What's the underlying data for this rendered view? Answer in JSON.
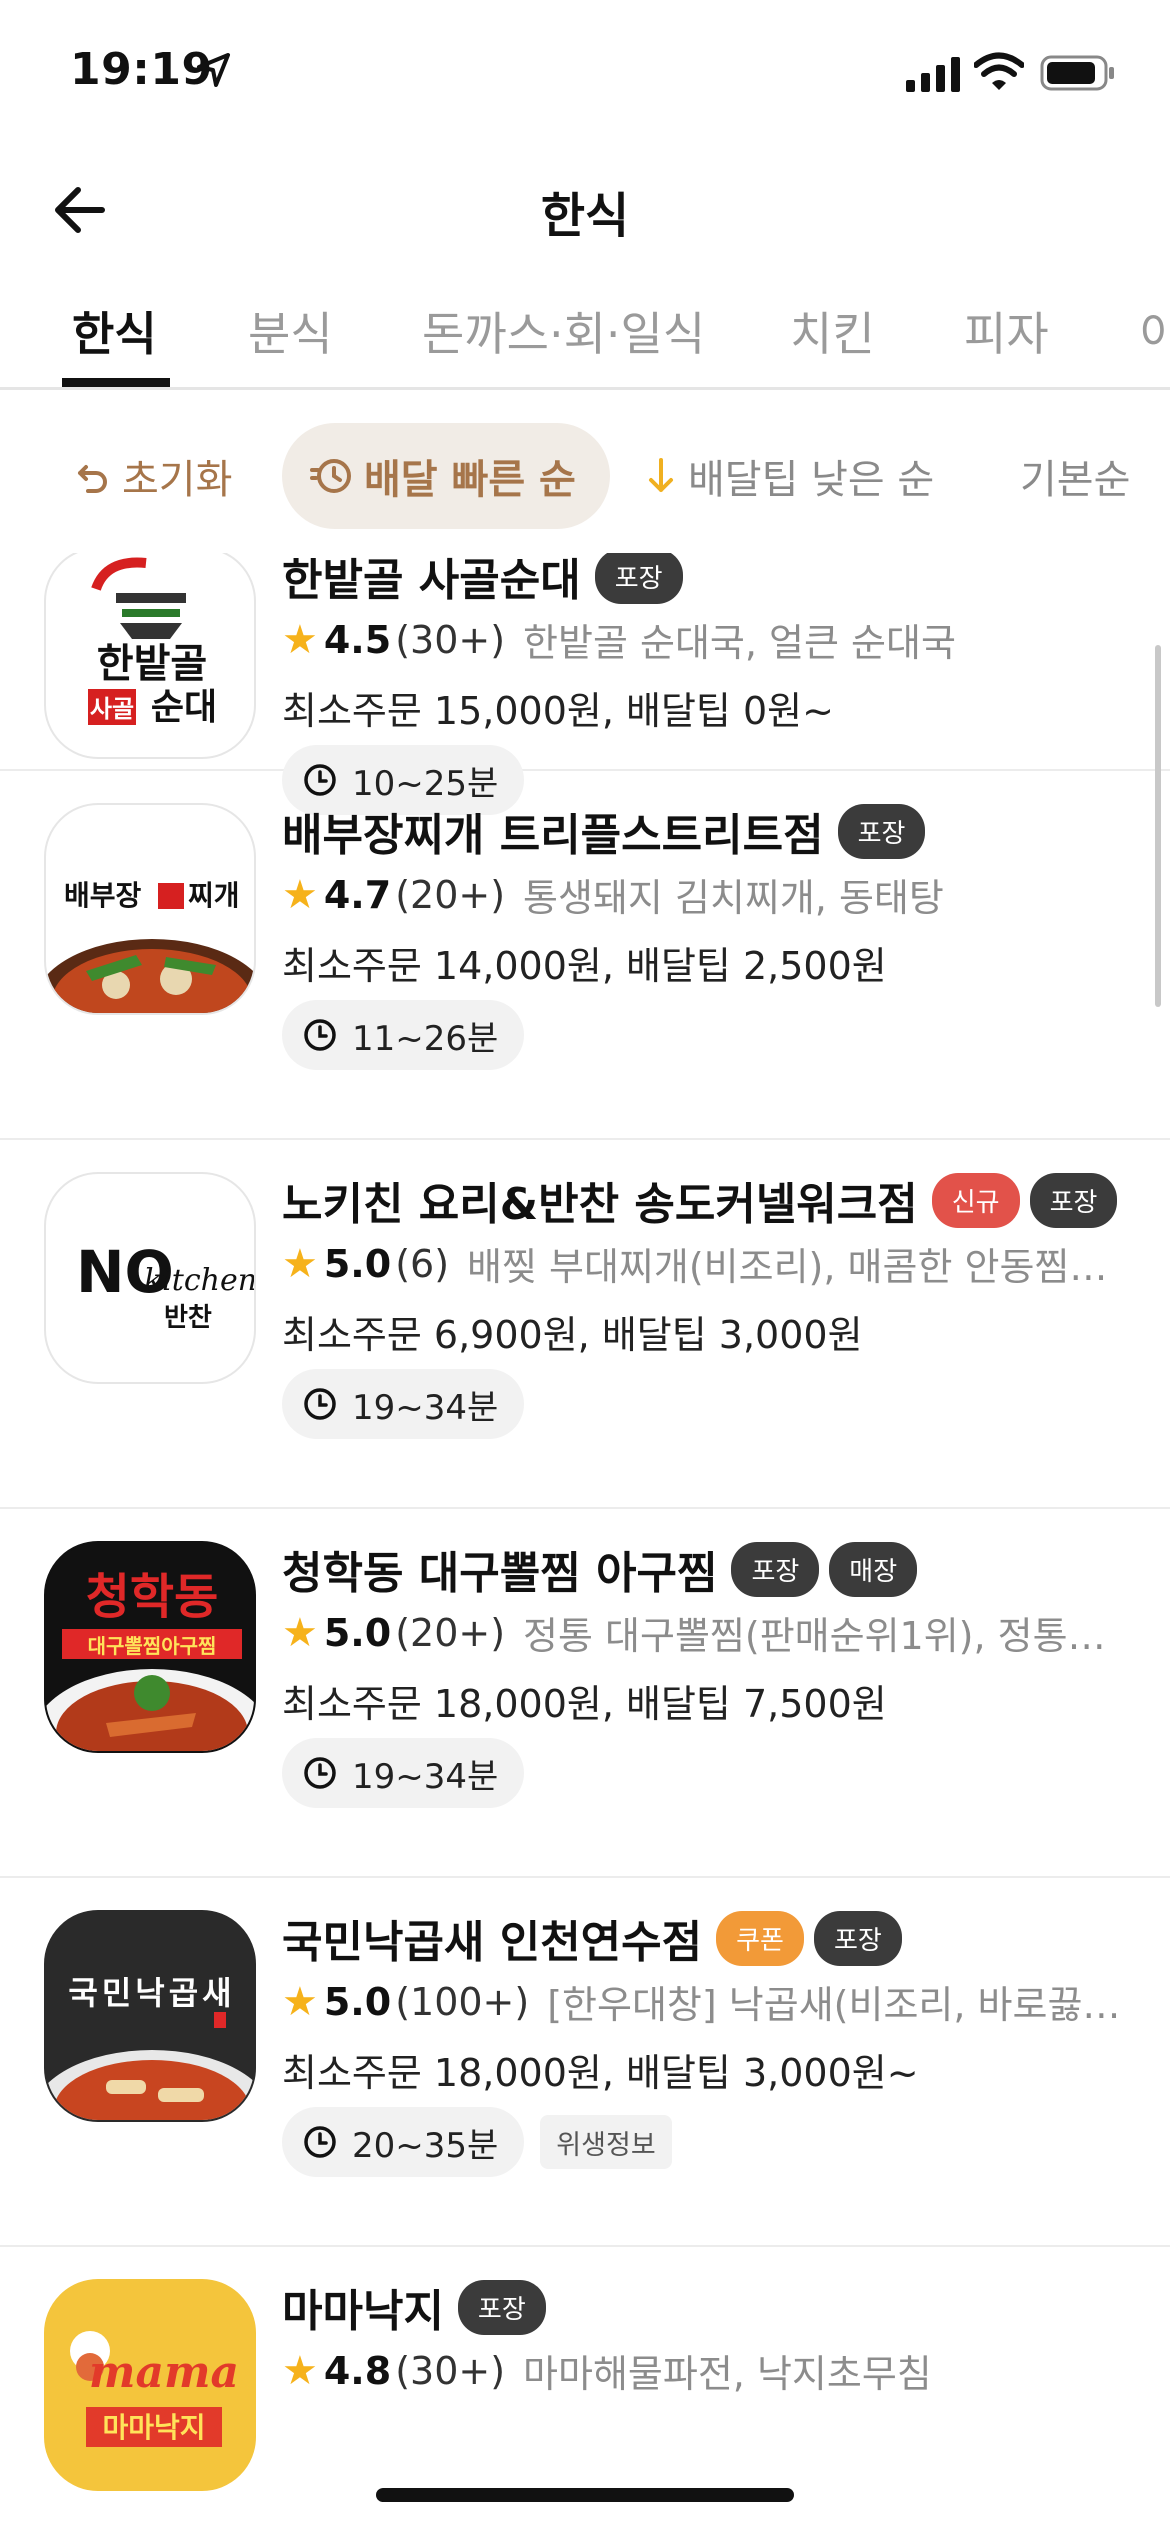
{
  "status_bar": {
    "time": "19:19"
  },
  "header": {
    "title": "한식"
  },
  "tabs": [
    {
      "label": "한식",
      "active": true
    },
    {
      "label": "분식"
    },
    {
      "label": "돈까스·회·일식"
    },
    {
      "label": "치킨"
    },
    {
      "label": "피자"
    },
    {
      "label": "아"
    }
  ],
  "sort": {
    "reset": "초기화",
    "fast": "배달 빠른 순",
    "tip": "배달팁 낮은 순",
    "basic": "기본순"
  },
  "colors": {
    "accent_brown": "#a6754a",
    "chip_bg": "#f1ece6",
    "star": "#f6b21b",
    "badge_dark": "#3b3b3b",
    "badge_new": "#e2524a",
    "badge_coupon": "#f29a38"
  },
  "restaurants": [
    {
      "name": "한밭골 사골순대",
      "badges": [
        {
          "label": "포장",
          "type": "dark"
        }
      ],
      "rating": "4.5",
      "reviews": "(30+)",
      "menu": "한밭골 순대국, 얼큰 순대국",
      "min_order": "최소주문 15,000원, 배달팁 0원~",
      "eta": "10~25분",
      "logo_text": [
        "한밭골",
        "사골",
        "순대"
      ]
    },
    {
      "name": "배부장찌개 트리플스트리트점",
      "badges": [
        {
          "label": "포장",
          "type": "dark"
        }
      ],
      "rating": "4.7",
      "reviews": "(20+)",
      "menu": "통생돼지 김치찌개, 동태탕",
      "min_order": "최소주문 14,000원, 배달팁 2,500원",
      "eta": "11~26분",
      "logo_text": [
        "배부장",
        "찌개"
      ]
    },
    {
      "name": "노키친 요리&반찬 송도커넬워크점",
      "badges": [
        {
          "label": "신규",
          "type": "new"
        },
        {
          "label": "포장",
          "type": "dark"
        }
      ],
      "rating": "5.0",
      "reviews": "(6)",
      "menu": "배찢 부대찌개(비조리), 매콤한 안동찜…",
      "min_order": "최소주문 6,900원, 배달팁 3,000원",
      "eta": "19~34분",
      "logo_text": [
        "NO",
        "kitchen",
        "반찬"
      ]
    },
    {
      "name": "청학동 대구뽈찜 아구찜",
      "badges": [
        {
          "label": "포장",
          "type": "dark"
        },
        {
          "label": "매장",
          "type": "dark"
        }
      ],
      "rating": "5.0",
      "reviews": "(20+)",
      "menu": "정통 대구뽈찜(판매순위1위), 정통…",
      "min_order": "최소주문 18,000원, 배달팁 7,500원",
      "eta": "19~34분",
      "logo_text": [
        "청학동",
        "대구뽈찜아구찜"
      ]
    },
    {
      "name": "국민낙곱새 인천연수점",
      "badges": [
        {
          "label": "쿠폰",
          "type": "coupon"
        },
        {
          "label": "포장",
          "type": "dark"
        }
      ],
      "rating": "5.0",
      "reviews": "(100+)",
      "menu": "[한우대창] 낙곱새(비조리, 바로끓…",
      "min_order": "최소주문 18,000원, 배달팁 3,000원~",
      "eta": "20~35분",
      "hygiene": "위생정보",
      "logo_text": [
        "국민낙곱새"
      ]
    },
    {
      "name": "마마낙지",
      "badges": [
        {
          "label": "포장",
          "type": "dark"
        }
      ],
      "rating": "4.8",
      "reviews": "(30+)",
      "menu": "마마해물파전, 낙지초무침",
      "logo_text": [
        "mama",
        "마마낙지"
      ]
    }
  ]
}
